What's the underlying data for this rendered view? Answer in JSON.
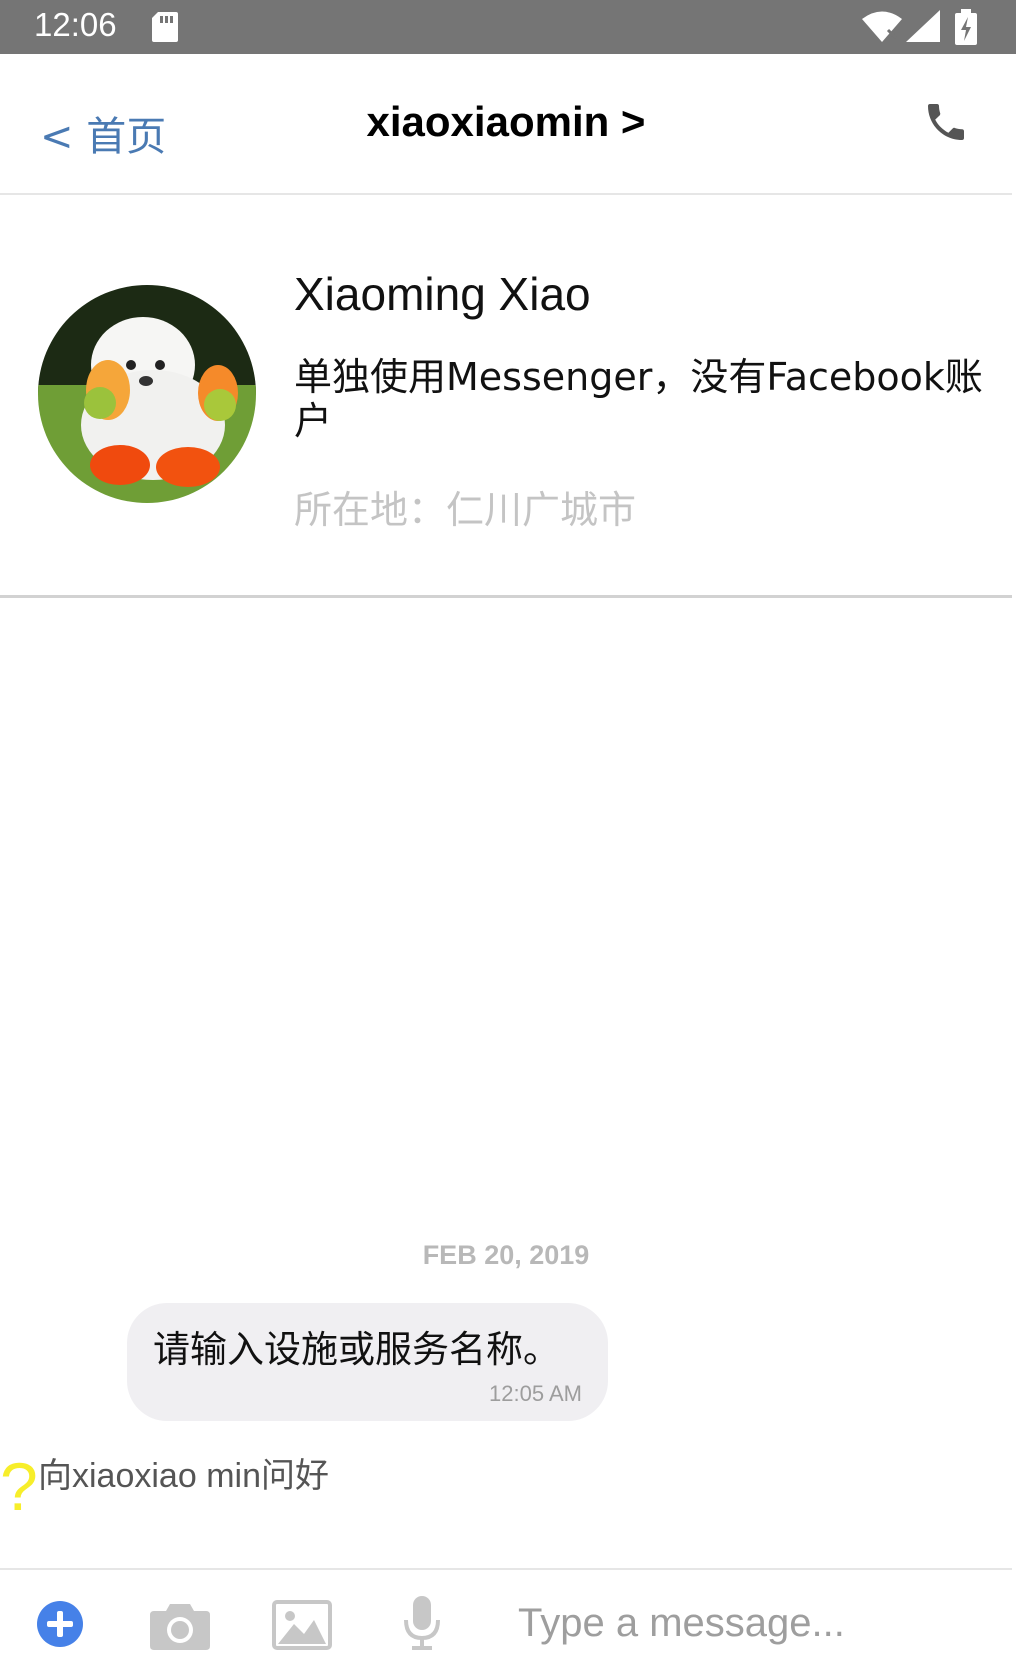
{
  "status_bar": {
    "time": "12:06",
    "icons": [
      "sd-card-icon",
      "wifi-icon",
      "signal-icon",
      "battery-icon"
    ]
  },
  "header": {
    "back_label": "< 首页",
    "title": "xiaoxiaomin >",
    "call_icon": "phone-icon",
    "back_color": "#4a7ab3"
  },
  "profile": {
    "avatar": "avatar-dog-photo",
    "name": "Xiaoming Xiao",
    "description": "单独使用Messenger，没有Facebook账户",
    "location": "所在地：仁川广城市"
  },
  "conversation": {
    "date": "FEB 20, 2019",
    "messages": [
      {
        "text": "请输入设施或服务名称。",
        "time": "12:05 AM"
      }
    ],
    "greeting_icon": "?",
    "greeting": "向xiaoxiao min问好"
  },
  "composer": {
    "icons": [
      "add-icon",
      "camera-icon",
      "image-icon",
      "microphone-icon"
    ],
    "placeholder": "Type a message...",
    "value": "",
    "accent_color": "#4681e8"
  }
}
